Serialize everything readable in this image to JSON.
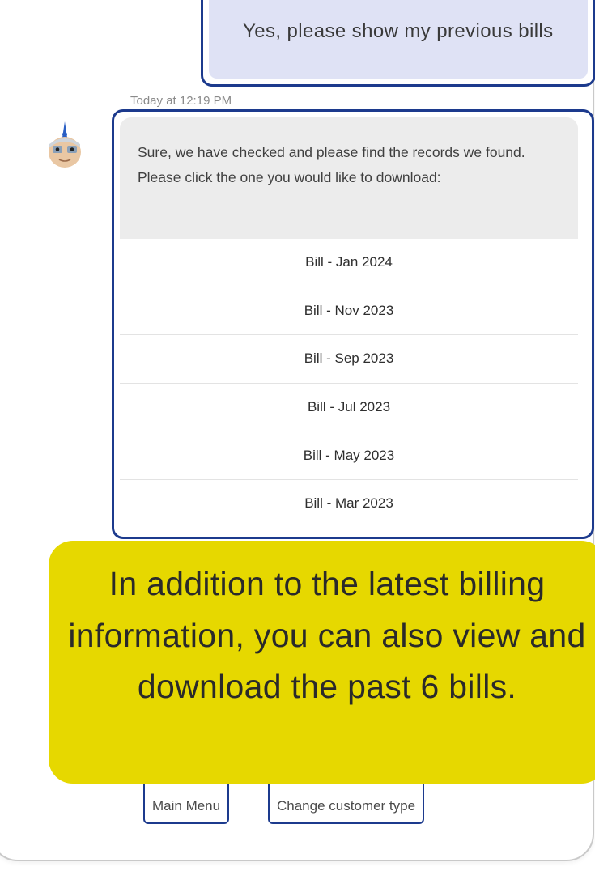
{
  "chat": {
    "user_message": "Yes, please show my previous bills",
    "timestamp": "Today at 12:19 PM",
    "bot_message": "Sure, we have checked and please find the records we found. Please click the one you would like to download:",
    "bill_options": [
      "Bill - Jan 2024",
      "Bill - Nov 2023",
      "Bill - Sep 2023",
      "Bill - Jul 2023",
      "Bill - May 2023",
      "Bill - Mar 2023"
    ]
  },
  "banner": {
    "text": "In addition to the latest billing information, you can also view and download the past 6 bills."
  },
  "footer": {
    "main_menu_label": "Main Menu",
    "change_customer_type_label": "Change customer type"
  },
  "colors": {
    "highlight_border": "#1c3a8d",
    "user_bubble": "#dfe2f5",
    "bot_bubble": "#ececec",
    "banner": "#e6d800"
  }
}
